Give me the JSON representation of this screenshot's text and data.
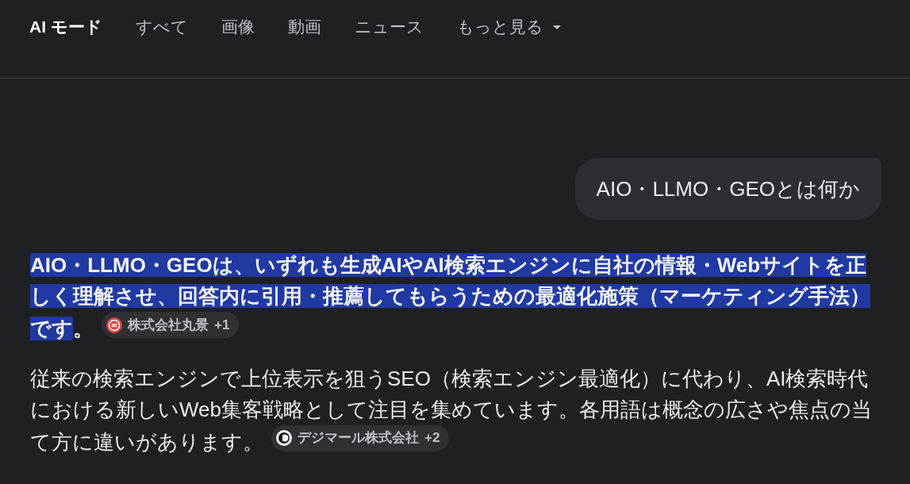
{
  "nav": {
    "tabs": [
      {
        "label": "AI モード",
        "selected": true,
        "kind": "tab"
      },
      {
        "label": "すべて",
        "selected": false,
        "kind": "tab"
      },
      {
        "label": "画像",
        "selected": false,
        "kind": "tab"
      },
      {
        "label": "動画",
        "selected": false,
        "kind": "tab"
      },
      {
        "label": "ニュース",
        "selected": false,
        "kind": "tab"
      },
      {
        "label": "もっと見る",
        "selected": false,
        "kind": "menu"
      }
    ]
  },
  "conversation": {
    "query": "AIO・LLMO・GEOとは何か",
    "answer": [
      {
        "kind": "lead",
        "segments": [
          {
            "text": "AIO・LLMO・GEOは、いずれも生成AIやAI検索エンジンに自社の情報・Webサイトを正しく理解させ、回答内に引用・推薦してもらうための最適化施策（マーケティング手法）です",
            "highlighted": true
          },
          {
            "text": "。",
            "highlighted": false
          }
        ],
        "citation": {
          "source": "株式会社丸景",
          "count": "+1"
        }
      },
      {
        "kind": "body",
        "segments": [
          {
            "text": "従来の検索エンジンで上位表示を狙うSEO（検索エンジン最適化）に代わり、AI検索時代における新しいWeb集客戦略として注目を集めています。各用語は概念の広さや焦点の当て方に違いがあります。",
            "highlighted": false
          }
        ],
        "citation": {
          "source": "デジマール株式会社",
          "count": "+2"
        }
      }
    ]
  }
}
